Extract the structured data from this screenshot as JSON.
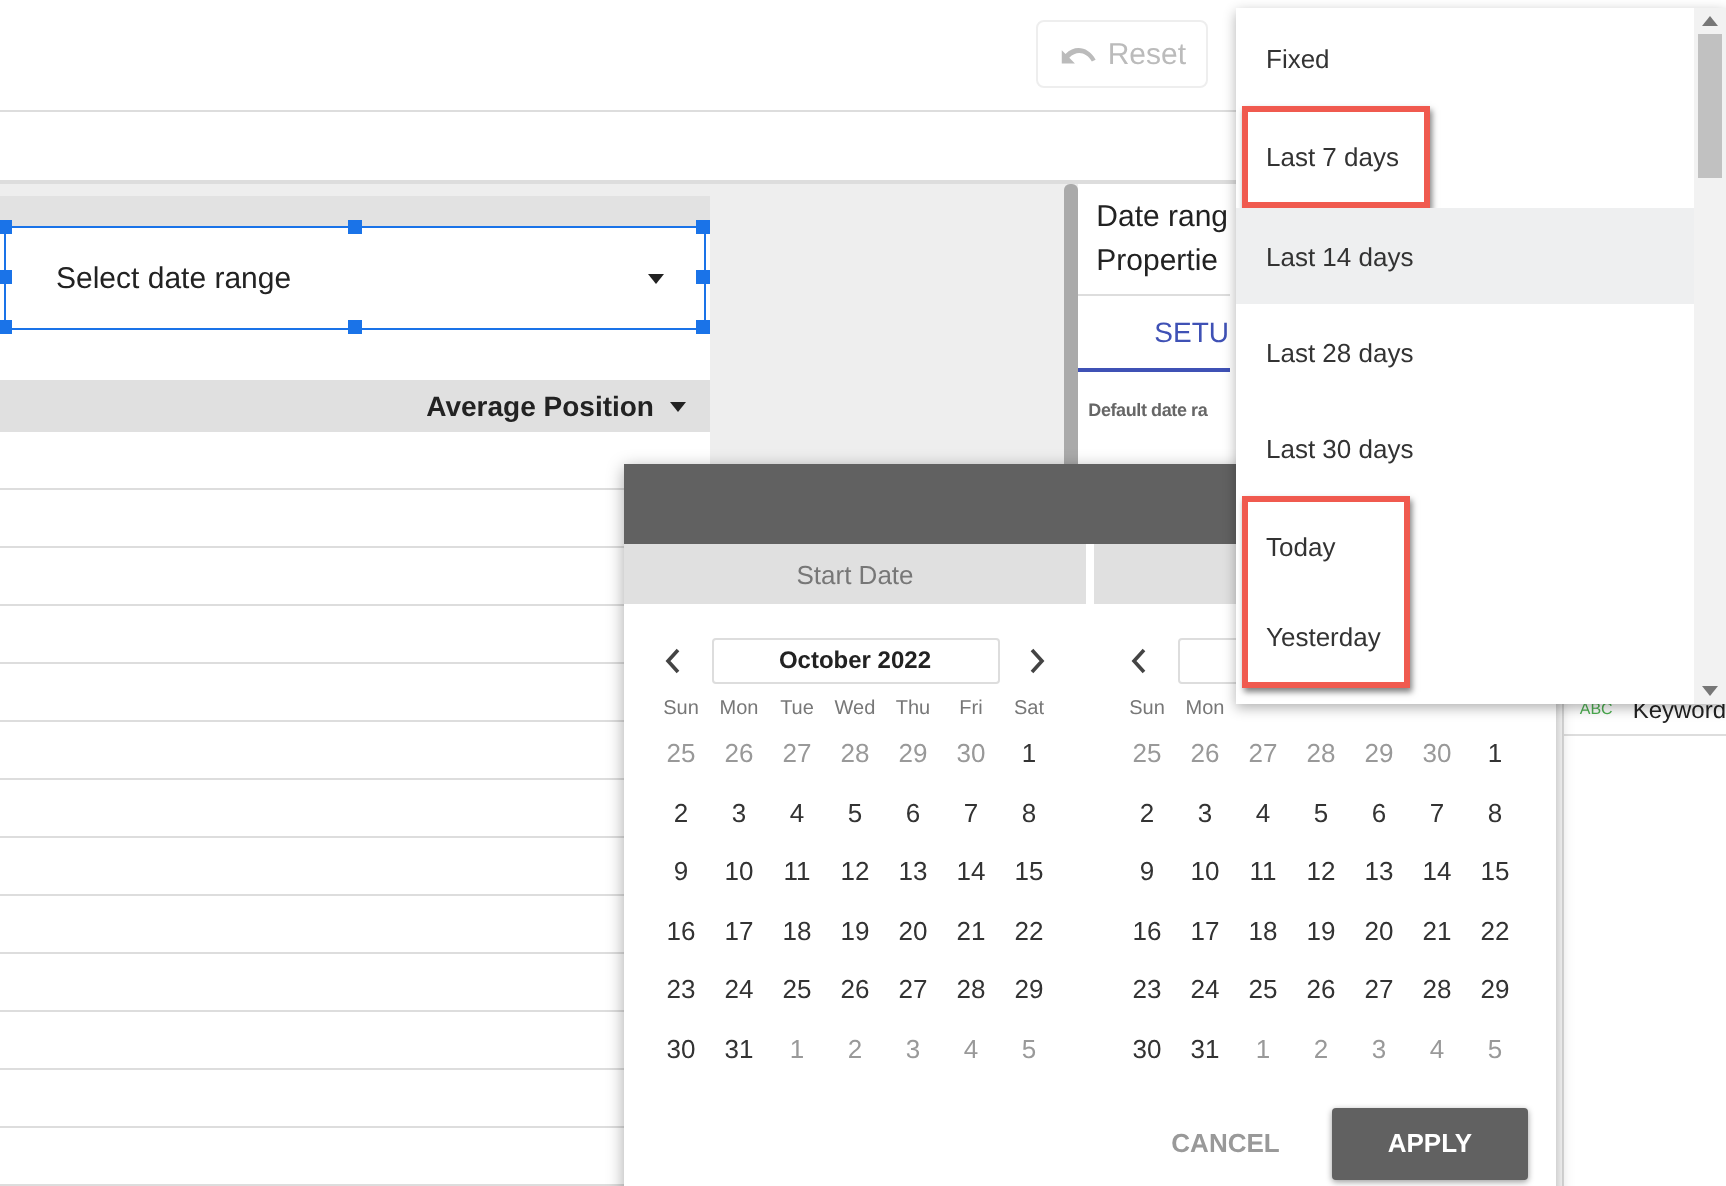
{
  "toolbar": {
    "reset_button": {
      "label": "Reset",
      "disabled": true
    }
  },
  "date_control": {
    "label": "Select date range",
    "selected": true
  },
  "table": {
    "columns": [
      {
        "label": "Average Position",
        "sorted": true
      }
    ]
  },
  "properties_panel": {
    "title_lines": [
      "Date rang",
      "Propertie"
    ],
    "tabs": [
      {
        "label": "SETU",
        "selected": true
      }
    ],
    "field_label": "Default date ra"
  },
  "data_panel": {
    "fields": [
      {
        "type": "ABC",
        "name": "Keyword"
      }
    ]
  },
  "date_picker": {
    "tabs": [
      {
        "label": "Start Date"
      }
    ],
    "calendars": [
      {
        "month": "October 2022",
        "weekdays": [
          "Sun",
          "Mon",
          "Tue",
          "Wed",
          "Thu",
          "Fri",
          "Sat"
        ],
        "weeks": [
          [
            {
              "day": "25",
              "outside": true
            },
            {
              "day": "26",
              "outside": true
            },
            {
              "day": "27",
              "outside": true
            },
            {
              "day": "28",
              "outside": true
            },
            {
              "day": "29",
              "outside": true
            },
            {
              "day": "30",
              "outside": true
            },
            {
              "day": "1",
              "outside": false
            }
          ],
          [
            {
              "day": "2",
              "outside": false
            },
            {
              "day": "3",
              "outside": false
            },
            {
              "day": "4",
              "outside": false
            },
            {
              "day": "5",
              "outside": false
            },
            {
              "day": "6",
              "outside": false
            },
            {
              "day": "7",
              "outside": false
            },
            {
              "day": "8",
              "outside": false
            }
          ],
          [
            {
              "day": "9",
              "outside": false
            },
            {
              "day": "10",
              "outside": false
            },
            {
              "day": "11",
              "outside": false
            },
            {
              "day": "12",
              "outside": false
            },
            {
              "day": "13",
              "outside": false
            },
            {
              "day": "14",
              "outside": false
            },
            {
              "day": "15",
              "outside": false
            }
          ],
          [
            {
              "day": "16",
              "outside": false
            },
            {
              "day": "17",
              "outside": false
            },
            {
              "day": "18",
              "outside": false
            },
            {
              "day": "19",
              "outside": false
            },
            {
              "day": "20",
              "outside": false
            },
            {
              "day": "21",
              "outside": false
            },
            {
              "day": "22",
              "outside": false
            }
          ],
          [
            {
              "day": "23",
              "outside": false
            },
            {
              "day": "24",
              "outside": false
            },
            {
              "day": "25",
              "outside": false
            },
            {
              "day": "26",
              "outside": false
            },
            {
              "day": "27",
              "outside": false
            },
            {
              "day": "28",
              "outside": false
            },
            {
              "day": "29",
              "outside": false
            }
          ],
          [
            {
              "day": "30",
              "outside": false
            },
            {
              "day": "31",
              "outside": false
            },
            {
              "day": "1",
              "outside": true
            },
            {
              "day": "2",
              "outside": true
            },
            {
              "day": "3",
              "outside": true
            },
            {
              "day": "4",
              "outside": true
            },
            {
              "day": "5",
              "outside": true
            }
          ]
        ]
      },
      {
        "weekdays": [
          "Sun",
          "Mon"
        ],
        "weeks": [
          [
            {
              "day": "25",
              "outside": true
            },
            {
              "day": "26",
              "outside": true
            },
            {
              "day": "27",
              "outside": true
            },
            {
              "day": "28",
              "outside": true
            },
            {
              "day": "29",
              "outside": true
            },
            {
              "day": "30",
              "outside": true
            },
            {
              "day": "1",
              "outside": false
            }
          ],
          [
            {
              "day": "2",
              "outside": false
            },
            {
              "day": "3",
              "outside": false
            },
            {
              "day": "4",
              "outside": false
            },
            {
              "day": "5",
              "outside": false
            },
            {
              "day": "6",
              "outside": false
            },
            {
              "day": "7",
              "outside": false
            },
            {
              "day": "8",
              "outside": false
            }
          ],
          [
            {
              "day": "9",
              "outside": false
            },
            {
              "day": "10",
              "outside": false
            },
            {
              "day": "11",
              "outside": false
            },
            {
              "day": "12",
              "outside": false
            },
            {
              "day": "13",
              "outside": false
            },
            {
              "day": "14",
              "outside": false
            },
            {
              "day": "15",
              "outside": false
            }
          ],
          [
            {
              "day": "16",
              "outside": false
            },
            {
              "day": "17",
              "outside": false
            },
            {
              "day": "18",
              "outside": false
            },
            {
              "day": "19",
              "outside": false
            },
            {
              "day": "20",
              "outside": false
            },
            {
              "day": "21",
              "outside": false
            },
            {
              "day": "22",
              "outside": false
            }
          ],
          [
            {
              "day": "23",
              "outside": false
            },
            {
              "day": "24",
              "outside": false
            },
            {
              "day": "25",
              "outside": false
            },
            {
              "day": "26",
              "outside": false
            },
            {
              "day": "27",
              "outside": false
            },
            {
              "day": "28",
              "outside": false
            },
            {
              "day": "29",
              "outside": false
            }
          ],
          [
            {
              "day": "30",
              "outside": false
            },
            {
              "day": "31",
              "outside": false
            },
            {
              "day": "1",
              "outside": true
            },
            {
              "day": "2",
              "outside": true
            },
            {
              "day": "3",
              "outside": true
            },
            {
              "day": "4",
              "outside": true
            },
            {
              "day": "5",
              "outside": true
            }
          ]
        ]
      }
    ],
    "buttons": [
      {
        "label": "CANCEL",
        "kind": "text"
      },
      {
        "label": "APPLY",
        "kind": "filled"
      }
    ]
  },
  "dropdown": {
    "items": [
      {
        "label": "Fixed",
        "highlighted": false,
        "outlined": false
      },
      {
        "label": "Last 7 days",
        "highlighted": false,
        "outlined": true
      },
      {
        "label": "Last 14 days",
        "highlighted": true,
        "outlined": false
      },
      {
        "label": "Last 28 days",
        "highlighted": false,
        "outlined": false
      },
      {
        "label": "Last 30 days",
        "highlighted": false,
        "outlined": false
      },
      {
        "label": "Today",
        "highlighted": false,
        "outlined": true
      },
      {
        "label": "Yesterday",
        "highlighted": false,
        "outlined": true
      }
    ]
  }
}
